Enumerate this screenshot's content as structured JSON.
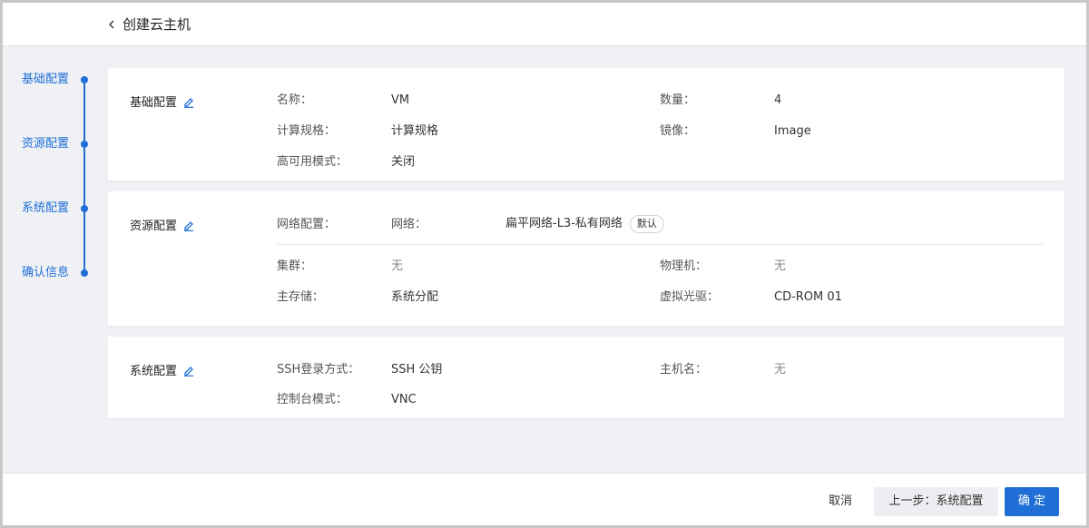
{
  "header": {
    "title": "创建云主机"
  },
  "stepper": {
    "steps": [
      {
        "label": "基础配置"
      },
      {
        "label": "资源配置"
      },
      {
        "label": "系统配置"
      },
      {
        "label": "确认信息"
      }
    ]
  },
  "basic": {
    "title": "基础配置",
    "name_label": "名称：",
    "name_value": "VM",
    "count_label": "数量：",
    "count_value": "4",
    "spec_label": "计算规格：",
    "spec_value": "计算规格",
    "image_label": "镜像：",
    "image_value": "Image",
    "ha_label": "高可用模式：",
    "ha_value": "关闭"
  },
  "resource": {
    "title": "资源配置",
    "netconf_label": "网络配置：",
    "network_label": "网络：",
    "network_value": "扁平网络-L3-私有网络",
    "default_badge": "默认",
    "cluster_label": "集群：",
    "cluster_value": "无",
    "host_label": "物理机：",
    "host_value": "无",
    "storage_label": "主存储：",
    "storage_value": "系统分配",
    "cdrom_label": "虚拟光驱：",
    "cdrom_value": "CD-ROM 01"
  },
  "system": {
    "title": "系统配置",
    "ssh_label": "SSH登录方式：",
    "ssh_value": "SSH 公钥",
    "hostname_label": "主机名：",
    "hostname_value": "无",
    "console_label": "控制台模式：",
    "console_value": "VNC"
  },
  "footer": {
    "cancel": "取消",
    "prev": "上一步：系统配置",
    "ok": "确 定"
  },
  "colors": {
    "accent": "#1f6fd6",
    "background": "#f0f1f5"
  }
}
